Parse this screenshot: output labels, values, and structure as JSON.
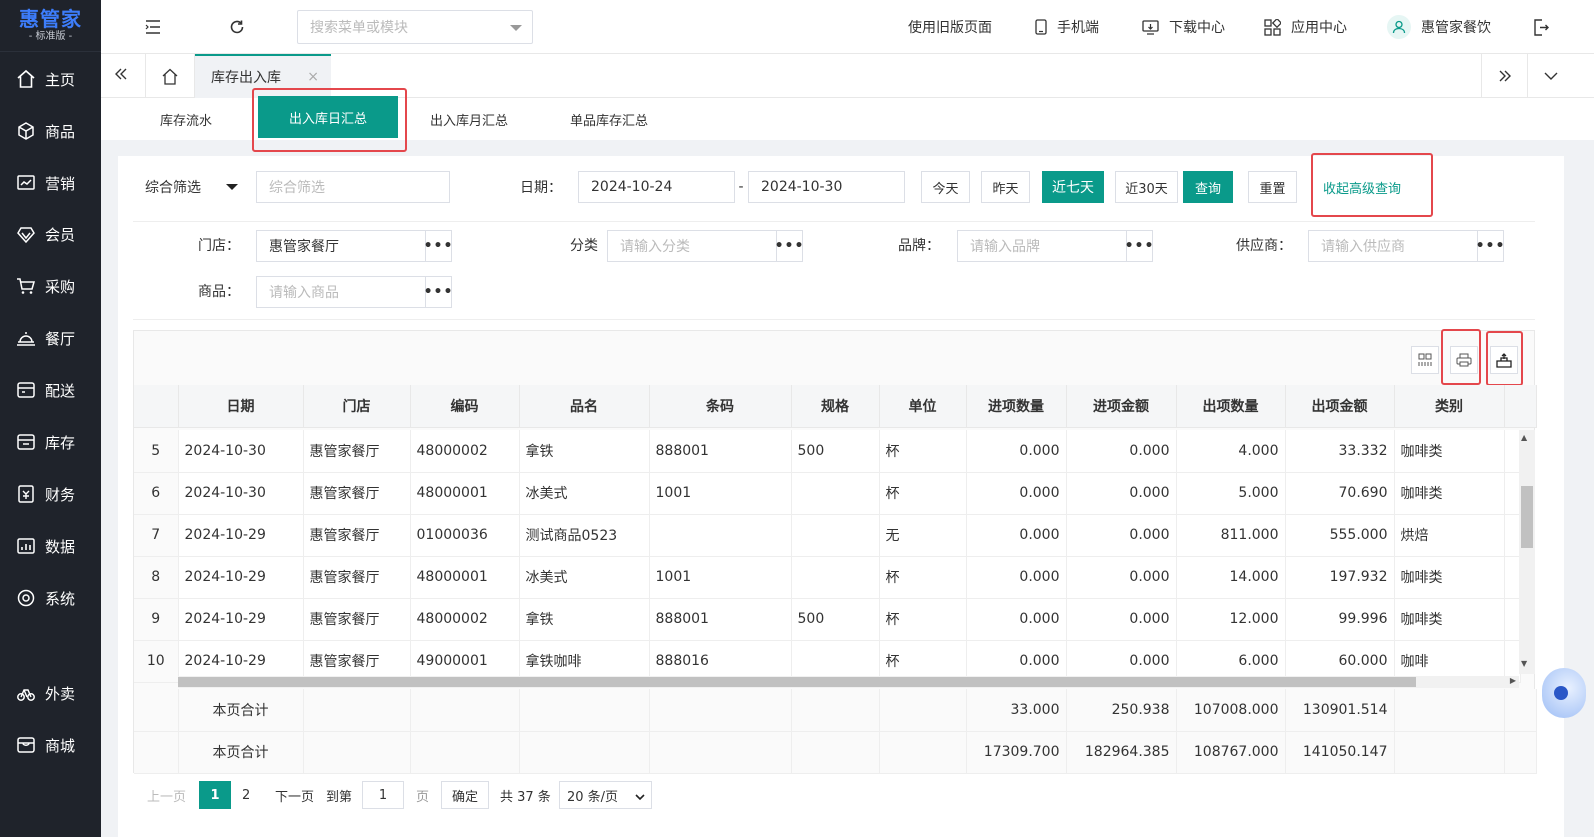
{
  "brand": {
    "name": "惠管家",
    "edition": "- 标准版 -"
  },
  "sidebar": {
    "items": [
      {
        "label": "主页",
        "icon": "home-icon"
      },
      {
        "label": "商品",
        "icon": "box-icon"
      },
      {
        "label": "营销",
        "icon": "chart-icon"
      },
      {
        "label": "会员",
        "icon": "diamond-icon"
      },
      {
        "label": "采购",
        "icon": "cart-icon"
      },
      {
        "label": "餐厅",
        "icon": "dish-icon"
      },
      {
        "label": "配送",
        "icon": "truck-icon"
      },
      {
        "label": "库存",
        "icon": "warehouse-icon"
      },
      {
        "label": "财务",
        "icon": "finance-icon"
      },
      {
        "label": "数据",
        "icon": "data-icon"
      },
      {
        "label": "系统",
        "icon": "settings-icon"
      },
      {
        "label": "外卖",
        "icon": "bike-icon"
      },
      {
        "label": "商城",
        "icon": "shop-icon"
      }
    ]
  },
  "header": {
    "search_placeholder": "搜索菜单或模块",
    "old_version": "使用旧版页面",
    "mobile": "手机端",
    "download": "下载中心",
    "apps": "应用中心",
    "user": "惠管家餐饮"
  },
  "tabs": {
    "current": "库存出入库"
  },
  "subtabs": [
    "库存流水",
    "出入库日汇总",
    "出入库月汇总",
    "单品库存汇总"
  ],
  "filters": {
    "combo": "综合筛选",
    "combo_placeholder": "综合筛选",
    "date_label": "日期：",
    "date_from": "2024-10-24",
    "date_sep": "-",
    "date_to": "2024-10-30",
    "btn_today": "今天",
    "btn_yesterday": "昨天",
    "btn_7days": "近七天",
    "btn_30days": "近30天",
    "btn_query": "查询",
    "btn_reset": "重置",
    "btn_collapse": "收起高级查询",
    "store_label": "门店：",
    "store_value": "惠管家餐厅",
    "category_label": "分类",
    "category_placeholder": "请输入分类",
    "brand_label": "品牌：",
    "brand_placeholder": "请输入品牌",
    "supplier_label": "供应商：",
    "supplier_placeholder": "请输入供应商",
    "product_label": "商品：",
    "product_placeholder": "请输入商品"
  },
  "table": {
    "columns": [
      "日期",
      "门店",
      "编码",
      "品名",
      "条码",
      "规格",
      "单位",
      "进项数量",
      "进项金额",
      "出项数量",
      "出项金额",
      "类别"
    ],
    "rows": [
      [
        "5",
        "2024-10-30",
        "惠管家餐厅",
        "48000002",
        "拿铁",
        "888001",
        "500",
        "杯",
        "0.000",
        "0.000",
        "4.000",
        "33.332",
        "咖啡类"
      ],
      [
        "6",
        "2024-10-30",
        "惠管家餐厅",
        "48000001",
        "冰美式",
        "1001",
        "",
        "杯",
        "0.000",
        "0.000",
        "5.000",
        "70.690",
        "咖啡类"
      ],
      [
        "7",
        "2024-10-29",
        "惠管家餐厅",
        "01000036",
        "测试商品0523",
        "",
        "",
        "无",
        "0.000",
        "0.000",
        "811.000",
        "555.000",
        "烘焙"
      ],
      [
        "8",
        "2024-10-29",
        "惠管家餐厅",
        "48000001",
        "冰美式",
        "1001",
        "",
        "杯",
        "0.000",
        "0.000",
        "14.000",
        "197.932",
        "咖啡类"
      ],
      [
        "9",
        "2024-10-29",
        "惠管家餐厅",
        "48000002",
        "拿铁",
        "888001",
        "500",
        "杯",
        "0.000",
        "0.000",
        "12.000",
        "99.996",
        "咖啡类"
      ],
      [
        "10",
        "2024-10-29",
        "惠管家餐厅",
        "49000001",
        "拿铁咖啡",
        "888016",
        "",
        "杯",
        "0.000",
        "0.000",
        "6.000",
        "60.000",
        "咖啡"
      ]
    ],
    "footer": [
      {
        "label": "本页合计",
        "in_qty": "33.000",
        "in_amt": "250.938",
        "out_qty": "107008.000",
        "out_amt": "130901.514"
      },
      {
        "label": "本页合计",
        "in_qty": "17309.700",
        "in_amt": "182964.385",
        "out_qty": "108767.000",
        "out_amt": "141050.147"
      }
    ]
  },
  "pager": {
    "prev": "上一页",
    "page1": "1",
    "page2": "2",
    "next": "下一页",
    "goto": "到第",
    "goto_value": "1",
    "page_unit": "页",
    "confirm": "确定",
    "total": "共 37 条",
    "size": "20 条/页"
  }
}
